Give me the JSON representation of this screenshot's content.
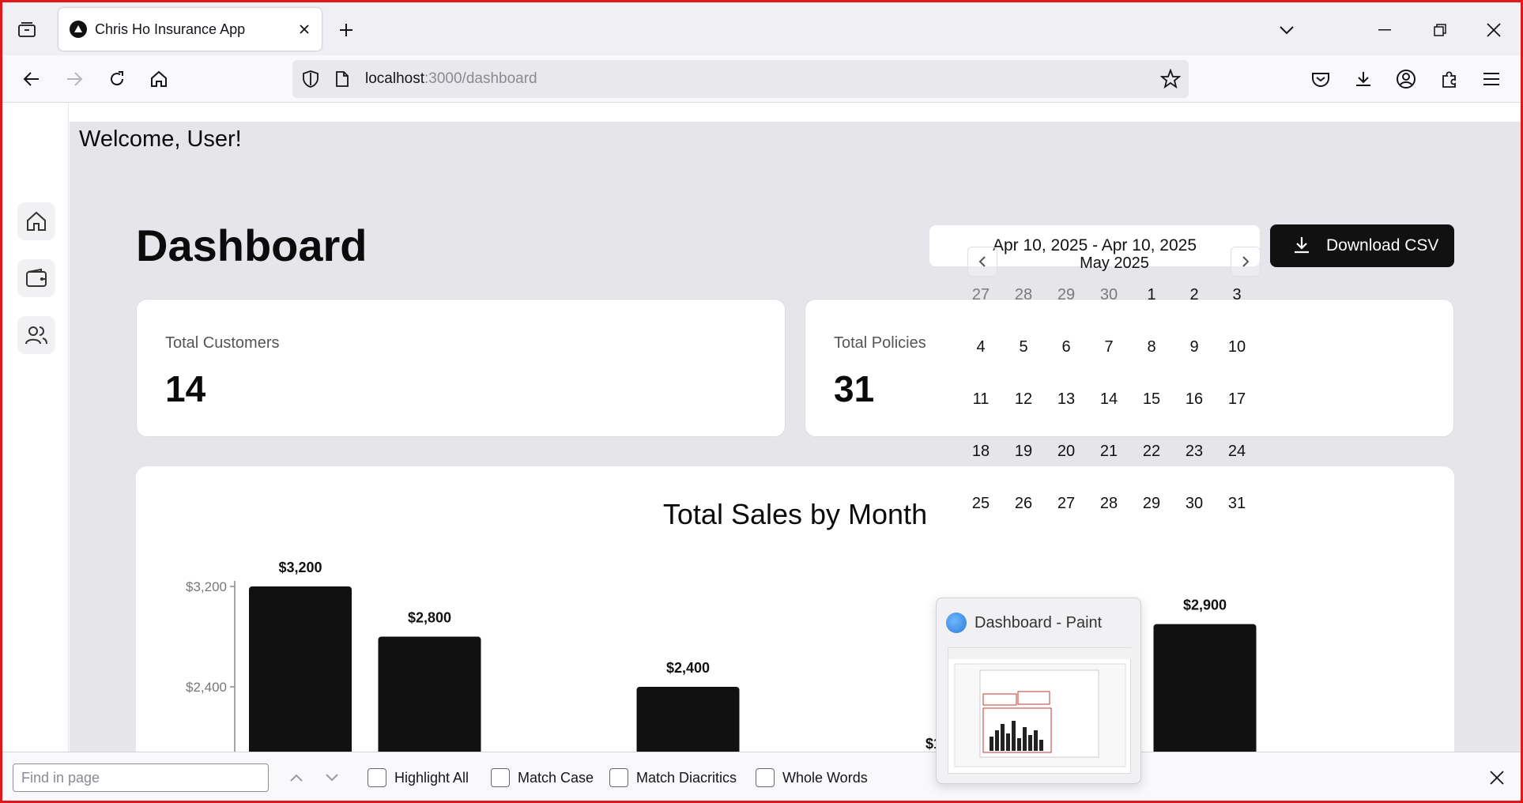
{
  "browser": {
    "tab_title": "Chris Ho Insurance App",
    "url_host": "localhost",
    "url_path": ":3000/dashboard"
  },
  "app": {
    "welcome": "Welcome, User!",
    "title": "Dashboard",
    "date_range": "Apr 10, 2025 - Apr 10, 2025",
    "download_label": "Download CSV",
    "stats": [
      {
        "label": "Total Customers",
        "value": "14"
      },
      {
        "label": "Total Policies",
        "value": "31"
      }
    ],
    "sidebar": [
      "home-icon",
      "wallet-icon",
      "users-icon"
    ]
  },
  "calendar": {
    "month": "May 2025",
    "weeks": [
      [
        "27",
        "28",
        "29",
        "30",
        "1",
        "2",
        "3"
      ],
      [
        "4",
        "5",
        "6",
        "7",
        "8",
        "9",
        "10"
      ],
      [
        "11",
        "12",
        "13",
        "14",
        "15",
        "16",
        "17"
      ],
      [
        "18",
        "19",
        "20",
        "21",
        "22",
        "23",
        "24"
      ],
      [
        "25",
        "26",
        "27",
        "28",
        "29",
        "30",
        "31"
      ]
    ],
    "muted_first_row_count": 4
  },
  "chart_data": {
    "type": "bar",
    "title": "Total Sales by Month",
    "y_ticks": [
      "$3,200",
      "$2,400"
    ],
    "y_tick_values": [
      3200,
      2400
    ],
    "bars": [
      {
        "value": 3200,
        "label": "$3,200",
        "slot": 0
      },
      {
        "value": 2800,
        "label": "$2,800",
        "slot": 1
      },
      {
        "value": 2400,
        "label": "$2,400",
        "slot": 3
      },
      {
        "value": 2900,
        "label": "$2,900",
        "slot": 7
      }
    ],
    "partial_label": "$1"
  },
  "thumbnail": {
    "title": "Dashboard - Paint"
  },
  "findbar": {
    "placeholder": "Find in page",
    "options": [
      "Highlight All",
      "Match Case",
      "Match Diacritics",
      "Whole Words"
    ]
  },
  "colors": {
    "accent": "#111111",
    "frame": "#e0181b",
    "page_bg": "#e6e6ea"
  }
}
